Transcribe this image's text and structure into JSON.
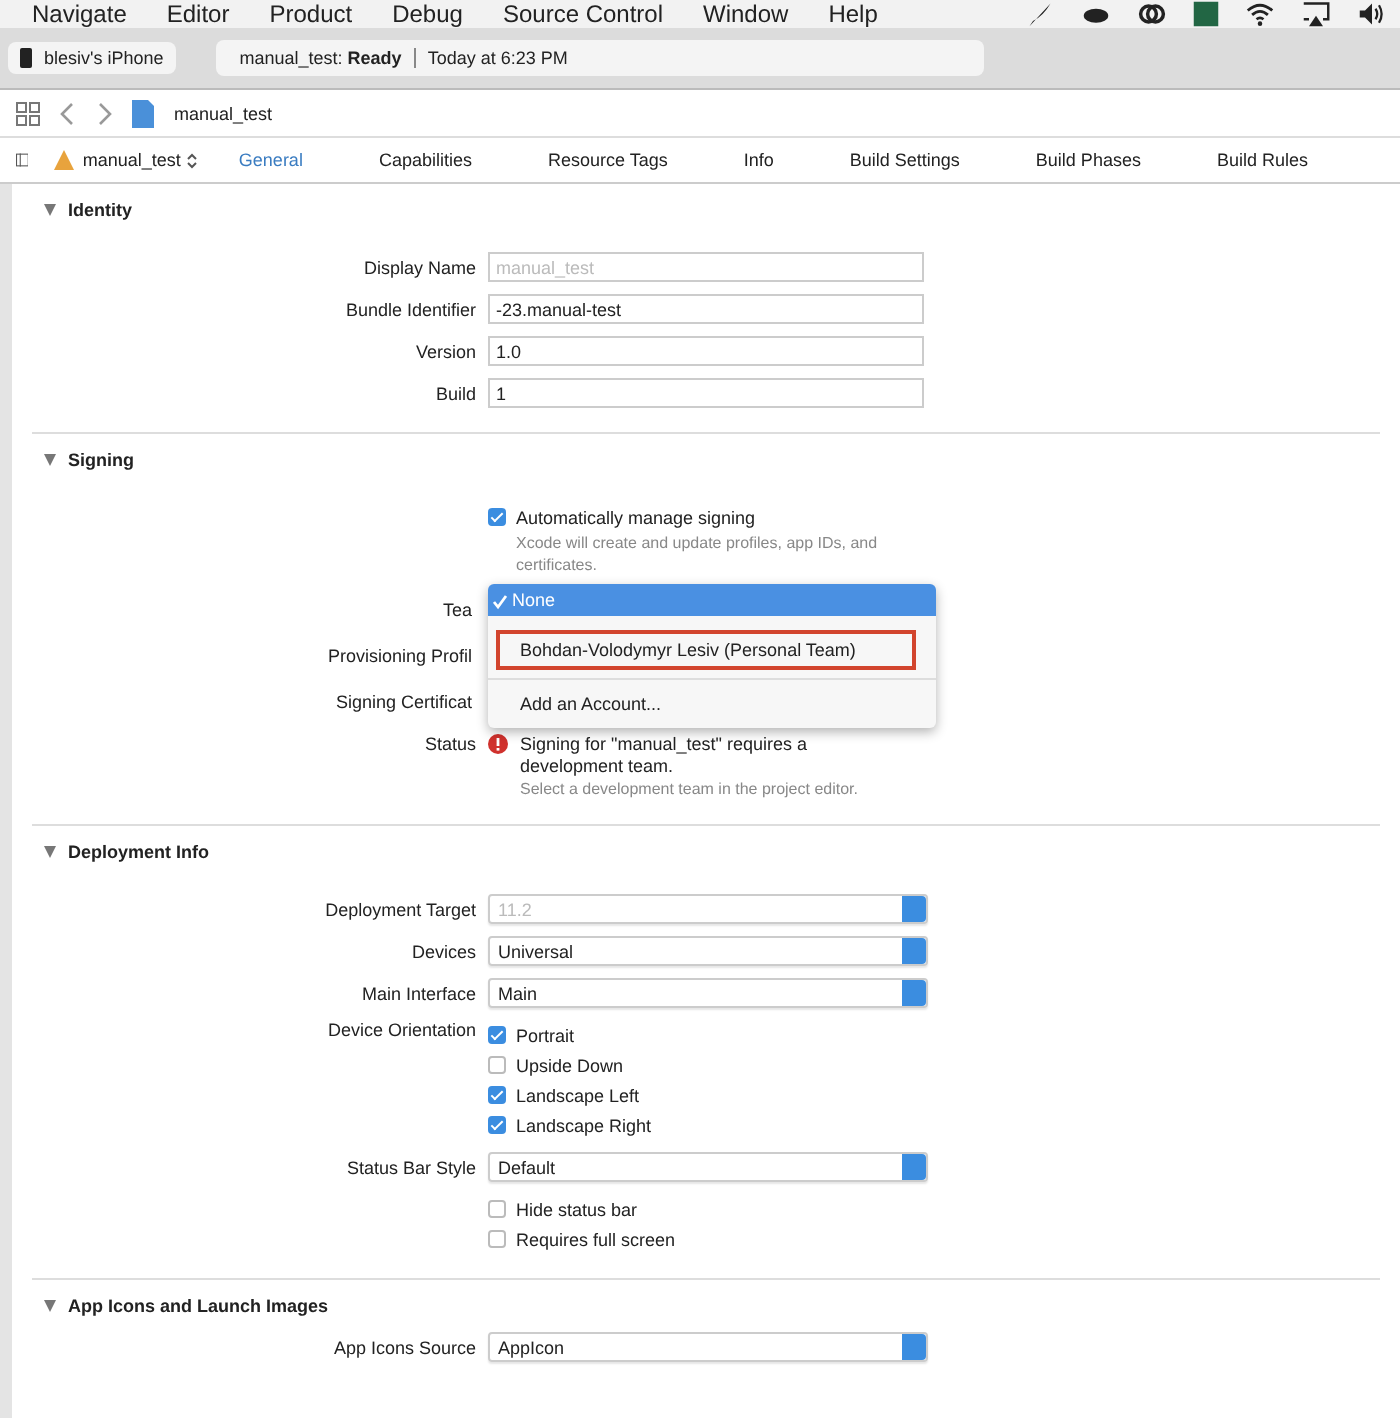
{
  "menu_bar": {
    "items": [
      "Navigate",
      "Editor",
      "Product",
      "Debug",
      "Source Control",
      "Window",
      "Help"
    ]
  },
  "toolbar": {
    "device": "blesiv's iPhone",
    "status": "manual_test: **Ready**",
    "time": "Today at 6:23 PM"
  },
  "path_bar": {
    "file": "manual_test"
  },
  "target": {
    "name": "manual_test"
  },
  "tabs": [
    {
      "label": "General",
      "selected": true
    },
    {
      "label": "Capabilities",
      "selected": false
    },
    {
      "label": "Resource Tags",
      "selected": false
    },
    {
      "label": "Info",
      "selected": false
    },
    {
      "label": "Build Settings",
      "selected": false
    },
    {
      "label": "Build Phases",
      "selected": false
    },
    {
      "label": "Build Rules",
      "selected": false
    }
  ],
  "identity": {
    "title": "Identity",
    "fields": [
      {
        "label": "Display Name",
        "placeholder": "manual_test"
      },
      {
        "label": "Bundle Identifier",
        "value": "-23.manual-test"
      },
      {
        "label": "Version",
        "value": "1.0"
      },
      {
        "label": "Build",
        "value": "1"
      }
    ]
  },
  "signing": {
    "title": "Signing",
    "auto": {
      "label": "Automatically manage signing",
      "checked": true,
      "note": "Xcode will create and update profiles, app IDs, and certificates."
    },
    "rows": [
      "Tea",
      "Provisioning Profil",
      "Signing Certificat"
    ],
    "menu": {
      "items": [
        {
          "label": "None",
          "selected": true,
          "highlighted": false
        },
        {
          "label": "Bohdan-Volodymyr Lesiv (Personal Team)",
          "selected": false,
          "highlighted": true
        },
        {
          "label": "Add an Account...",
          "selected": false,
          "highlighted": false
        }
      ]
    },
    "status": {
      "label": "Status",
      "message": "Signing for \"manual_test\" requires a development team.",
      "hint": "Select a development team in the project editor."
    }
  },
  "deployment": {
    "title": "Deployment Info",
    "popups": [
      {
        "label": "Deployment Target",
        "value": "11.2",
        "disabled": true
      },
      {
        "label": "Devices",
        "value": "Universal",
        "disabled": false
      },
      {
        "label": "Main Interface",
        "value": "Main",
        "disabled": false
      }
    ],
    "orientation": {
      "label": "Device Orientation",
      "options": [
        {
          "label": "Portrait",
          "checked": true
        },
        {
          "label": "Upside Down",
          "checked": false
        },
        {
          "label": "Landscape Left",
          "checked": true
        },
        {
          "label": "Landscape Right",
          "checked": true
        }
      ]
    },
    "status_bar_style": {
      "label": "Status Bar Style",
      "value": "Default"
    },
    "options": [
      {
        "label": "Hide status bar",
        "checked": false
      },
      {
        "label": "Requires full screen",
        "checked": false
      }
    ]
  },
  "app_icons": {
    "title": "App Icons and Launch Images",
    "source": {
      "label": "App Icons Source",
      "value": "AppIcon"
    }
  }
}
